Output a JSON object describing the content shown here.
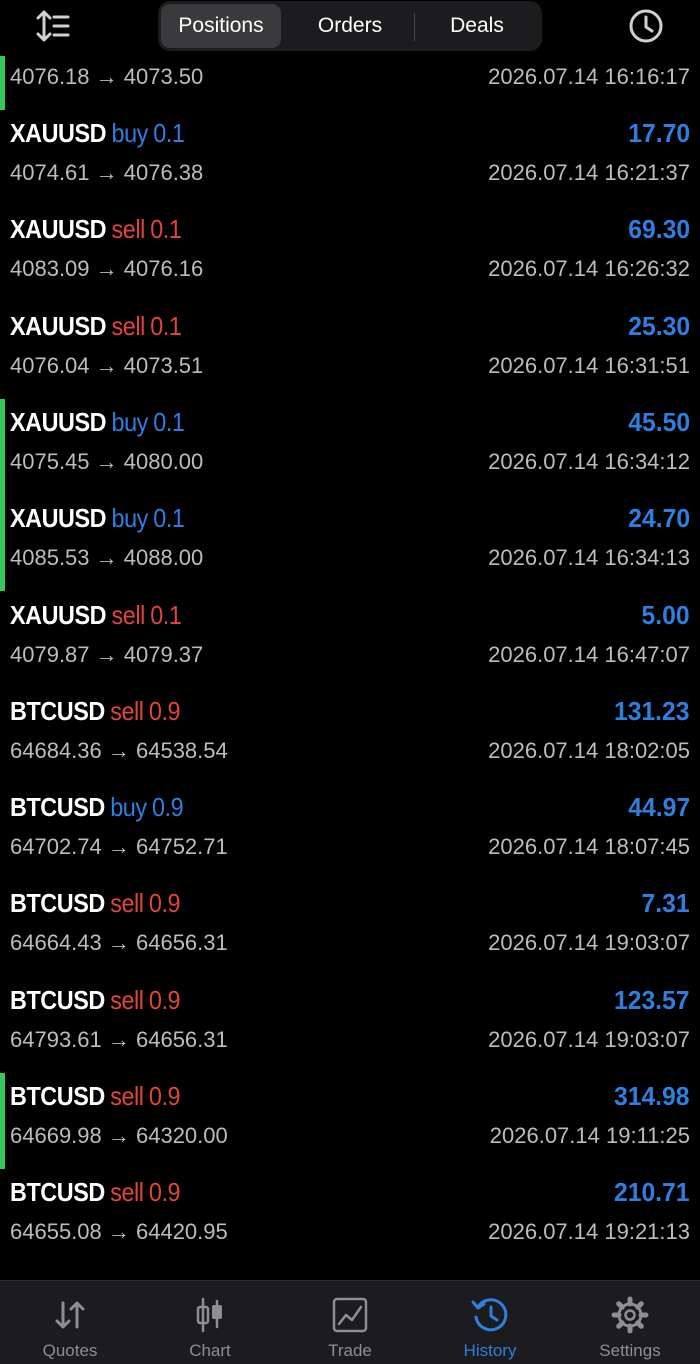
{
  "header": {
    "tabs": [
      {
        "label": "Positions",
        "active": true
      },
      {
        "label": "Orders",
        "active": false
      },
      {
        "label": "Deals",
        "active": false
      }
    ],
    "sort_icon": "sort-icon",
    "history_icon": "clock-icon"
  },
  "colors": {
    "buy": "#2e7fe0",
    "sell": "#e0443c",
    "profit": "#2e7fe0",
    "bar": "#34c759",
    "muted": "#bdbdbd"
  },
  "top_partial": {
    "prices": "4076.18 → 4073.50",
    "time": "2026.07.14 16:16:17",
    "highlighted": true
  },
  "deals": [
    {
      "symbol": "XAUUSD",
      "side": "buy",
      "volume": "0.1",
      "profit": "17.70",
      "prices": "4074.61 → 4076.38",
      "time": "2026.07.14 16:21:37",
      "highlighted": false
    },
    {
      "symbol": "XAUUSD",
      "side": "sell",
      "volume": "0.1",
      "profit": "69.30",
      "prices": "4083.09 → 4076.16",
      "time": "2026.07.14 16:26:32",
      "highlighted": false
    },
    {
      "symbol": "XAUUSD",
      "side": "sell",
      "volume": "0.1",
      "profit": "25.30",
      "prices": "4076.04 → 4073.51",
      "time": "2026.07.14 16:31:51",
      "highlighted": false
    },
    {
      "symbol": "XAUUSD",
      "side": "buy",
      "volume": "0.1",
      "profit": "45.50",
      "prices": "4075.45 → 4080.00",
      "time": "2026.07.14 16:34:12",
      "highlighted": true
    },
    {
      "symbol": "XAUUSD",
      "side": "buy",
      "volume": "0.1",
      "profit": "24.70",
      "prices": "4085.53 → 4088.00",
      "time": "2026.07.14 16:34:13",
      "highlighted": true
    },
    {
      "symbol": "XAUUSD",
      "side": "sell",
      "volume": "0.1",
      "profit": "5.00",
      "prices": "4079.87 → 4079.37",
      "time": "2026.07.14 16:47:07",
      "highlighted": false
    },
    {
      "symbol": "BTCUSD",
      "side": "sell",
      "volume": "0.9",
      "profit": "131.23",
      "prices": "64684.36 → 64538.54",
      "time": "2026.07.14 18:02:05",
      "highlighted": false
    },
    {
      "symbol": "BTCUSD",
      "side": "buy",
      "volume": "0.9",
      "profit": "44.97",
      "prices": "64702.74 → 64752.71",
      "time": "2026.07.14 18:07:45",
      "highlighted": false
    },
    {
      "symbol": "BTCUSD",
      "side": "sell",
      "volume": "0.9",
      "profit": "7.31",
      "prices": "64664.43 → 64656.31",
      "time": "2026.07.14 19:03:07",
      "highlighted": false
    },
    {
      "symbol": "BTCUSD",
      "side": "sell",
      "volume": "0.9",
      "profit": "123.57",
      "prices": "64793.61 → 64656.31",
      "time": "2026.07.14 19:03:07",
      "highlighted": false
    },
    {
      "symbol": "BTCUSD",
      "side": "sell",
      "volume": "0.9",
      "profit": "314.98",
      "prices": "64669.98 → 64320.00",
      "time": "2026.07.14 19:11:25",
      "highlighted": true
    },
    {
      "symbol": "BTCUSD",
      "side": "sell",
      "volume": "0.9",
      "profit": "210.71",
      "prices": "64655.08 → 64420.95",
      "time": "2026.07.14 19:21:13",
      "highlighted": false
    }
  ],
  "tabbar": [
    {
      "label": "Quotes",
      "icon": "quotes-icon",
      "active": false
    },
    {
      "label": "Chart",
      "icon": "chart-icon",
      "active": false
    },
    {
      "label": "Trade",
      "icon": "trade-icon",
      "active": false
    },
    {
      "label": "History",
      "icon": "history-icon",
      "active": true
    },
    {
      "label": "Settings",
      "icon": "gear-icon",
      "active": false
    }
  ]
}
